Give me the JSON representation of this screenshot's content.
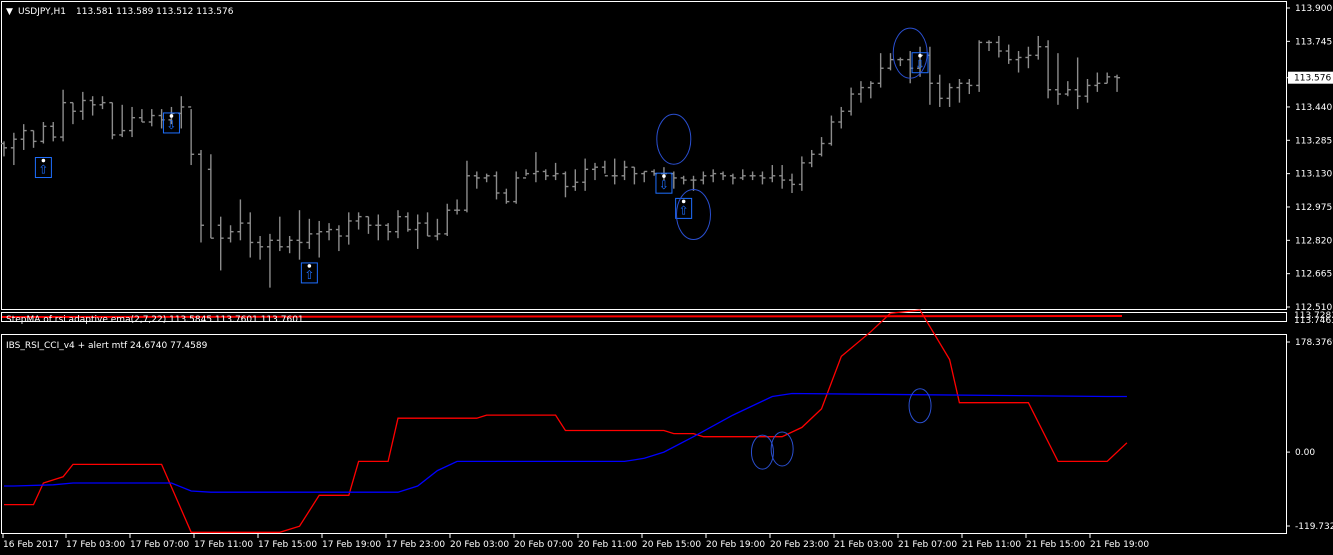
{
  "header": {
    "symbol": "USDJPY,H1",
    "quote": "113.581 113.589 113.512 113.576"
  },
  "subpanel": {
    "label": "StepMA of rsi adaptive ema(2,7,22) 113.5845 113.7601 113.7601",
    "scale_top": "113.7281",
    "scale_bottom": "113.7463"
  },
  "indicator": {
    "label": "IBS_RSI_CCI_v4 + alert mtf 24.6740 77.4589"
  },
  "colors": {
    "background": "#000000",
    "grid": "#ffffff",
    "bars": "#8c8c8c",
    "red_line": "#ff0000",
    "blue_line": "#0000ff",
    "arrow": "#1e6fff",
    "circle": "#2a4fd0"
  },
  "chart_data": [
    {
      "type": "ohlc",
      "y_ticks": [
        "113.900",
        "113.745",
        "113.576",
        "113.440",
        "113.285",
        "113.130",
        "112.975",
        "112.820",
        "112.665",
        "112.510"
      ],
      "current_price_label": "113.576",
      "ylim": [
        112.51,
        113.9
      ],
      "x_ticks": [
        "16 Feb 2017",
        "17 Feb 03:00",
        "17 Feb 07:00",
        "17 Feb 11:00",
        "17 Feb 15:00",
        "17 Feb 19:00",
        "17 Feb 23:00",
        "20 Feb 03:00",
        "20 Feb 07:00",
        "20 Feb 11:00",
        "20 Feb 15:00",
        "20 Feb 19:00",
        "20 Feb 23:00",
        "21 Feb 03:00",
        "21 Feb 07:00",
        "21 Feb 11:00",
        "21 Feb 15:00",
        "21 Feb 19:00"
      ],
      "bars": [
        [
          0,
          113.27,
          113.28,
          113.21,
          113.25
        ],
        [
          1,
          113.25,
          113.32,
          113.17,
          113.29
        ],
        [
          2,
          113.29,
          113.36,
          113.24,
          113.33
        ],
        [
          3,
          113.33,
          113.33,
          113.25,
          113.28
        ],
        [
          4,
          113.28,
          113.37,
          113.27,
          113.35
        ],
        [
          5,
          113.35,
          113.37,
          113.28,
          113.3
        ],
        [
          6,
          113.3,
          113.52,
          113.28,
          113.46
        ],
        [
          7,
          113.46,
          113.46,
          113.36,
          113.42
        ],
        [
          8,
          113.42,
          113.51,
          113.38,
          113.47
        ],
        [
          9,
          113.47,
          113.49,
          113.4,
          113.45
        ],
        [
          10,
          113.45,
          113.49,
          113.43,
          113.46
        ],
        [
          11,
          113.46,
          113.46,
          113.29,
          113.31
        ],
        [
          12,
          113.31,
          113.45,
          113.3,
          113.33
        ],
        [
          13,
          113.33,
          113.44,
          113.3,
          113.39
        ],
        [
          14,
          113.39,
          113.43,
          113.37,
          113.37
        ],
        [
          15,
          113.37,
          113.43,
          113.35,
          113.4
        ],
        [
          16,
          113.4,
          113.43,
          113.34,
          113.38
        ],
        [
          17,
          113.38,
          113.44,
          113.36,
          113.41
        ],
        [
          18,
          113.41,
          113.49,
          113.34,
          113.44
        ],
        [
          19,
          113.44,
          113.43,
          113.17,
          113.22
        ],
        [
          20,
          113.22,
          113.24,
          112.81,
          112.89
        ],
        [
          21,
          113.15,
          113.22,
          112.83,
          112.83
        ],
        [
          22,
          112.89,
          112.93,
          112.68,
          112.83
        ],
        [
          23,
          112.83,
          112.89,
          112.81,
          112.86
        ],
        [
          24,
          112.86,
          113.01,
          112.82,
          112.9
        ],
        [
          25,
          112.9,
          112.95,
          112.74,
          112.81
        ],
        [
          26,
          112.81,
          112.84,
          112.73,
          112.79
        ],
        [
          27,
          112.79,
          112.85,
          112.6,
          112.82
        ],
        [
          28,
          112.82,
          112.93,
          112.77,
          112.79
        ],
        [
          29,
          112.79,
          112.84,
          112.76,
          112.82
        ],
        [
          30,
          112.82,
          112.96,
          112.73,
          112.81
        ],
        [
          31,
          112.81,
          112.92,
          112.78,
          112.85
        ],
        [
          32,
          112.85,
          112.91,
          112.74,
          112.86
        ],
        [
          33,
          112.86,
          112.9,
          112.82,
          112.87
        ],
        [
          34,
          112.87,
          112.89,
          112.77,
          112.84
        ],
        [
          35,
          112.84,
          112.95,
          112.8,
          112.91
        ],
        [
          36,
          112.91,
          112.95,
          112.87,
          112.93
        ],
        [
          37,
          112.93,
          112.93,
          112.85,
          112.89
        ],
        [
          38,
          112.89,
          112.94,
          112.82,
          112.89
        ],
        [
          39,
          112.89,
          112.9,
          112.82,
          112.86
        ],
        [
          40,
          112.86,
          112.96,
          112.83,
          112.93
        ],
        [
          41,
          112.93,
          112.95,
          112.86,
          112.87
        ],
        [
          42,
          112.87,
          112.94,
          112.78,
          112.9
        ],
        [
          43,
          112.9,
          112.95,
          112.84,
          112.84
        ],
        [
          44,
          112.84,
          112.92,
          112.82,
          112.85
        ],
        [
          45,
          112.85,
          112.99,
          112.84,
          112.96
        ],
        [
          46,
          112.96,
          113.01,
          112.94,
          112.96
        ],
        [
          47,
          112.96,
          113.19,
          112.95,
          113.12
        ],
        [
          48,
          113.12,
          113.14,
          113.06,
          113.11
        ],
        [
          49,
          113.11,
          113.13,
          113.09,
          113.12
        ],
        [
          50,
          113.12,
          113.14,
          113.01,
          113.04
        ],
        [
          51,
          113.04,
          113.06,
          112.99,
          113.0
        ],
        [
          52,
          113.0,
          113.14,
          112.99,
          113.11
        ],
        [
          53,
          113.11,
          113.15,
          113.12,
          113.13
        ],
        [
          54,
          113.13,
          113.23,
          113.09,
          113.14
        ],
        [
          55,
          113.14,
          113.15,
          113.1,
          113.12
        ],
        [
          56,
          113.12,
          113.18,
          113.1,
          113.13
        ],
        [
          57,
          113.13,
          113.14,
          113.02,
          113.07
        ],
        [
          58,
          113.07,
          113.15,
          113.05,
          113.09
        ],
        [
          59,
          113.09,
          113.2,
          113.05,
          113.15
        ],
        [
          60,
          113.15,
          113.18,
          113.1,
          113.16
        ],
        [
          61,
          113.16,
          113.19,
          113.13,
          113.12
        ],
        [
          62,
          113.12,
          113.2,
          113.08,
          113.12
        ],
        [
          63,
          113.12,
          113.19,
          113.1,
          113.16
        ],
        [
          64,
          113.16,
          113.16,
          113.08,
          113.13
        ],
        [
          65,
          113.13,
          113.14,
          113.09,
          113.14
        ],
        [
          66,
          113.14,
          113.15,
          113.12,
          113.13
        ],
        [
          67,
          113.13,
          113.16,
          113.1,
          113.13
        ],
        [
          68,
          113.13,
          113.14,
          113.06,
          113.11
        ],
        [
          69,
          113.11,
          113.12,
          113.08,
          113.1
        ],
        [
          70,
          113.1,
          113.12,
          113.05,
          113.1
        ],
        [
          71,
          113.1,
          113.14,
          113.08,
          113.12
        ],
        [
          72,
          113.12,
          113.15,
          113.09,
          113.13
        ],
        [
          73,
          113.13,
          113.14,
          113.1,
          113.12
        ],
        [
          74,
          113.12,
          113.13,
          113.08,
          113.11
        ],
        [
          75,
          113.11,
          113.15,
          113.1,
          113.12
        ],
        [
          76,
          113.12,
          113.14,
          113.1,
          113.12
        ],
        [
          77,
          113.12,
          113.14,
          113.08,
          113.11
        ],
        [
          78,
          113.11,
          113.17,
          113.09,
          113.12
        ],
        [
          79,
          113.12,
          113.17,
          113.06,
          113.1
        ],
        [
          80,
          113.1,
          113.13,
          113.04,
          113.08
        ],
        [
          81,
          113.08,
          113.21,
          113.05,
          113.18
        ],
        [
          82,
          113.18,
          113.24,
          113.16,
          113.22
        ],
        [
          83,
          113.22,
          113.3,
          113.21,
          113.27
        ],
        [
          84,
          113.27,
          113.4,
          113.26,
          113.37
        ],
        [
          85,
          113.37,
          113.44,
          113.34,
          113.42
        ],
        [
          86,
          113.42,
          113.53,
          113.4,
          113.5
        ],
        [
          87,
          113.5,
          113.56,
          113.46,
          113.53
        ],
        [
          88,
          113.53,
          113.56,
          113.48,
          113.55
        ],
        [
          89,
          113.55,
          113.69,
          113.53,
          113.62
        ],
        [
          90,
          113.62,
          113.69,
          113.61,
          113.66
        ],
        [
          91,
          113.66,
          113.67,
          113.63,
          113.66
        ],
        [
          92,
          113.66,
          113.7,
          113.55,
          113.62
        ],
        [
          93,
          113.62,
          113.72,
          113.58,
          113.68
        ],
        [
          94,
          113.68,
          113.72,
          113.45,
          113.55
        ],
        [
          95,
          113.55,
          113.59,
          113.44,
          113.48
        ],
        [
          96,
          113.48,
          113.55,
          113.44,
          113.53
        ],
        [
          97,
          113.53,
          113.57,
          113.46,
          113.55
        ],
        [
          98,
          113.55,
          113.57,
          113.5,
          113.54
        ],
        [
          99,
          113.54,
          113.75,
          113.51,
          113.74
        ],
        [
          100,
          113.74,
          113.75,
          113.7,
          113.74
        ],
        [
          101,
          113.74,
          113.77,
          113.67,
          113.7
        ],
        [
          102,
          113.7,
          113.73,
          113.64,
          113.66
        ],
        [
          103,
          113.66,
          113.7,
          113.6,
          113.67
        ],
        [
          104,
          113.67,
          113.72,
          113.62,
          113.68
        ],
        [
          105,
          113.68,
          113.77,
          113.66,
          113.72
        ],
        [
          106,
          113.72,
          113.75,
          113.48,
          113.52
        ],
        [
          107,
          113.52,
          113.69,
          113.45,
          113.5
        ],
        [
          108,
          113.5,
          113.56,
          113.49,
          113.52
        ],
        [
          109,
          113.52,
          113.67,
          113.43,
          113.49
        ],
        [
          110,
          113.49,
          113.57,
          113.46,
          113.54
        ],
        [
          111,
          113.54,
          113.6,
          113.51,
          113.55
        ],
        [
          112,
          113.55,
          113.6,
          113.55,
          113.58
        ],
        [
          113,
          113.58,
          113.59,
          113.51,
          113.576
        ]
      ],
      "signals": [
        {
          "dir": "up",
          "bar": 4
        },
        {
          "dir": "down",
          "bar": 17
        },
        {
          "dir": "up",
          "bar": 31
        },
        {
          "dir": "down",
          "bar": 67
        },
        {
          "dir": "up",
          "bar": 69
        },
        {
          "dir": "down",
          "bar": 93
        }
      ],
      "highlight_circles": [
        {
          "bar": 68,
          "price": 113.29
        },
        {
          "bar": 70,
          "price": 112.94
        },
        {
          "bar": 92,
          "price": 113.69
        }
      ]
    },
    {
      "type": "line",
      "y_ticks": [
        "178.3769",
        "0.00",
        "-119.7325"
      ],
      "ylim": [
        -119.7325,
        178.3769
      ],
      "series": [
        {
          "color": "#ff0000",
          "points": [
            [
              0,
              -85
            ],
            [
              3,
              -85
            ],
            [
              4,
              -50
            ],
            [
              6,
              -40
            ],
            [
              7,
              -20
            ],
            [
              9,
              -20
            ],
            [
              16,
              -20
            ],
            [
              19,
              -130
            ],
            [
              21,
              -130
            ],
            [
              28,
              -130
            ],
            [
              30,
              -120
            ],
            [
              32,
              -70
            ],
            [
              34,
              -70
            ],
            [
              35,
              -70
            ],
            [
              36,
              -15
            ],
            [
              39,
              -15
            ],
            [
              40,
              55
            ],
            [
              48,
              55
            ],
            [
              49,
              60
            ],
            [
              56,
              60
            ],
            [
              57,
              35
            ],
            [
              67,
              35
            ],
            [
              68,
              30
            ],
            [
              70,
              30
            ],
            [
              71,
              25
            ],
            [
              79,
              25
            ],
            [
              81,
              40
            ],
            [
              83,
              70
            ],
            [
              85,
              155
            ],
            [
              88,
              195
            ],
            [
              90,
              225
            ],
            [
              93,
              230
            ],
            [
              96,
              150
            ],
            [
              97,
              80
            ],
            [
              104,
              80
            ],
            [
              107,
              -15
            ],
            [
              112,
              -15
            ],
            [
              114,
              15
            ]
          ]
        },
        {
          "color": "#0000ff",
          "points": [
            [
              0,
              -55
            ],
            [
              1,
              -55
            ],
            [
              5,
              -53
            ],
            [
              7,
              -50
            ],
            [
              17,
              -50
            ],
            [
              19,
              -63
            ],
            [
              21,
              -65
            ],
            [
              40,
              -65
            ],
            [
              42,
              -55
            ],
            [
              44,
              -30
            ],
            [
              46,
              -15
            ],
            [
              47,
              -15
            ],
            [
              63,
              -15
            ],
            [
              65,
              -10
            ],
            [
              67,
              0
            ],
            [
              70,
              25
            ],
            [
              74,
              60
            ],
            [
              78,
              90
            ],
            [
              80,
              95
            ],
            [
              112,
              90
            ],
            [
              114,
              90
            ]
          ]
        }
      ],
      "highlight_circles": [
        {
          "bar": 77,
          "value": 0
        },
        {
          "bar": 79,
          "value": 5
        },
        {
          "bar": 93,
          "value": 75
        }
      ]
    }
  ]
}
